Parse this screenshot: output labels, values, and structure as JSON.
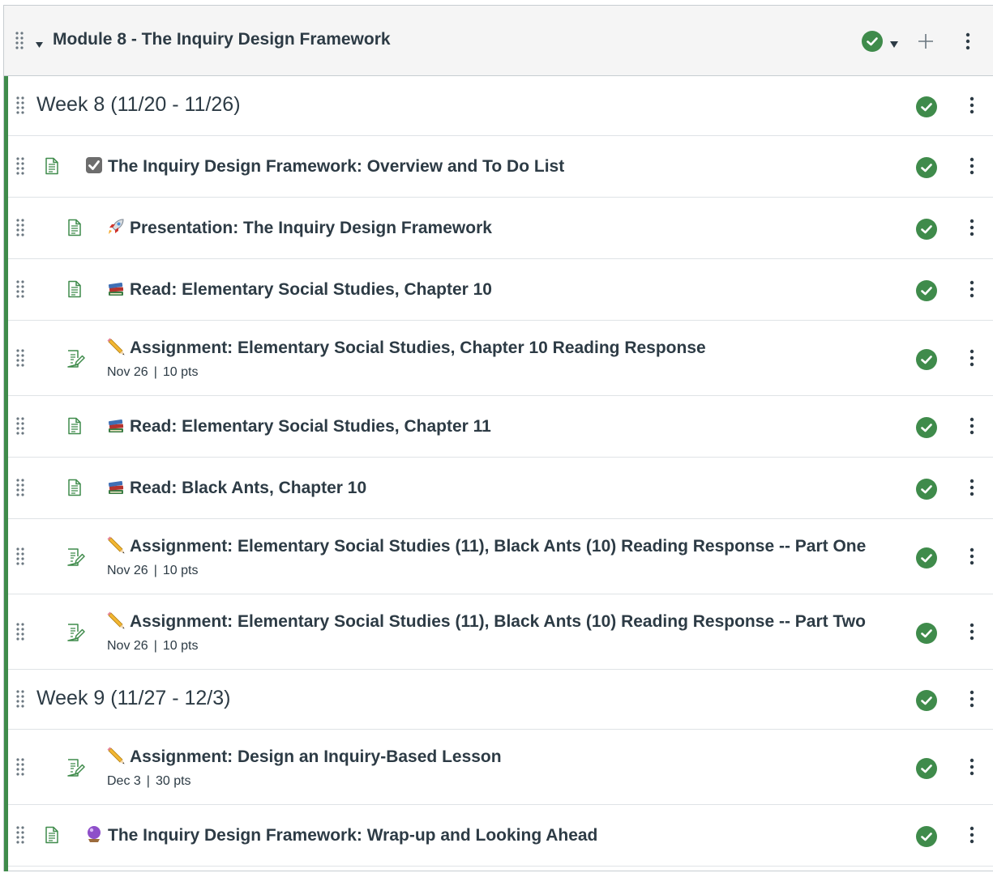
{
  "module": {
    "title": "Module 8 - The Inquiry Design Framework",
    "published": true
  },
  "items": [
    {
      "kind": "subheader",
      "title": "Week 8 (11/20 - 11/26)"
    },
    {
      "kind": "page",
      "indent": 0,
      "emoji": "checkbox",
      "title": "The Inquiry Design Framework: Overview and To Do List"
    },
    {
      "kind": "page",
      "indent": 1,
      "emoji": "rocket",
      "title": "Presentation: The Inquiry Design Framework"
    },
    {
      "kind": "page",
      "indent": 1,
      "emoji": "books",
      "title": "Read: Elementary Social Studies, Chapter 10"
    },
    {
      "kind": "assignment",
      "indent": 1,
      "emoji": "pencil",
      "title": "Assignment: Elementary Social Studies, Chapter 10 Reading Response",
      "due": "Nov 26",
      "points": "10 pts"
    },
    {
      "kind": "page",
      "indent": 1,
      "emoji": "books",
      "title": "Read: Elementary Social Studies, Chapter 11"
    },
    {
      "kind": "page",
      "indent": 1,
      "emoji": "books",
      "title": "Read: Black Ants, Chapter 10"
    },
    {
      "kind": "assignment",
      "indent": 1,
      "emoji": "pencil",
      "title": "Assignment: Elementary Social Studies (11), Black Ants (10) Reading Response -- Part One",
      "due": "Nov 26",
      "points": "10 pts"
    },
    {
      "kind": "assignment",
      "indent": 1,
      "emoji": "pencil",
      "title": "Assignment: Elementary Social Studies (11), Black Ants (10) Reading Response -- Part Two",
      "due": "Nov 26",
      "points": "10 pts"
    },
    {
      "kind": "subheader",
      "title": "Week 9 (11/27 - 12/3)"
    },
    {
      "kind": "assignment",
      "indent": 1,
      "emoji": "pencil",
      "title": "Assignment: Design an Inquiry-Based Lesson",
      "due": "Dec 3",
      "points": "30 pts"
    },
    {
      "kind": "page",
      "indent": 0,
      "emoji": "crystal-ball",
      "title": "The Inquiry Design Framework: Wrap-up and Looking Ahead"
    }
  ],
  "separator": "|",
  "colors": {
    "published_green": "#3f8b4b",
    "text": "#2d3b45",
    "icon_green": "#3f8b4b"
  },
  "icons": {
    "drag": "drag-handle-icon",
    "expand": "caret-down-icon",
    "publish": "published-check-icon",
    "add": "plus-icon",
    "menu": "kebab-menu-icon",
    "page": "document-icon",
    "assignment": "assignment-icon"
  }
}
